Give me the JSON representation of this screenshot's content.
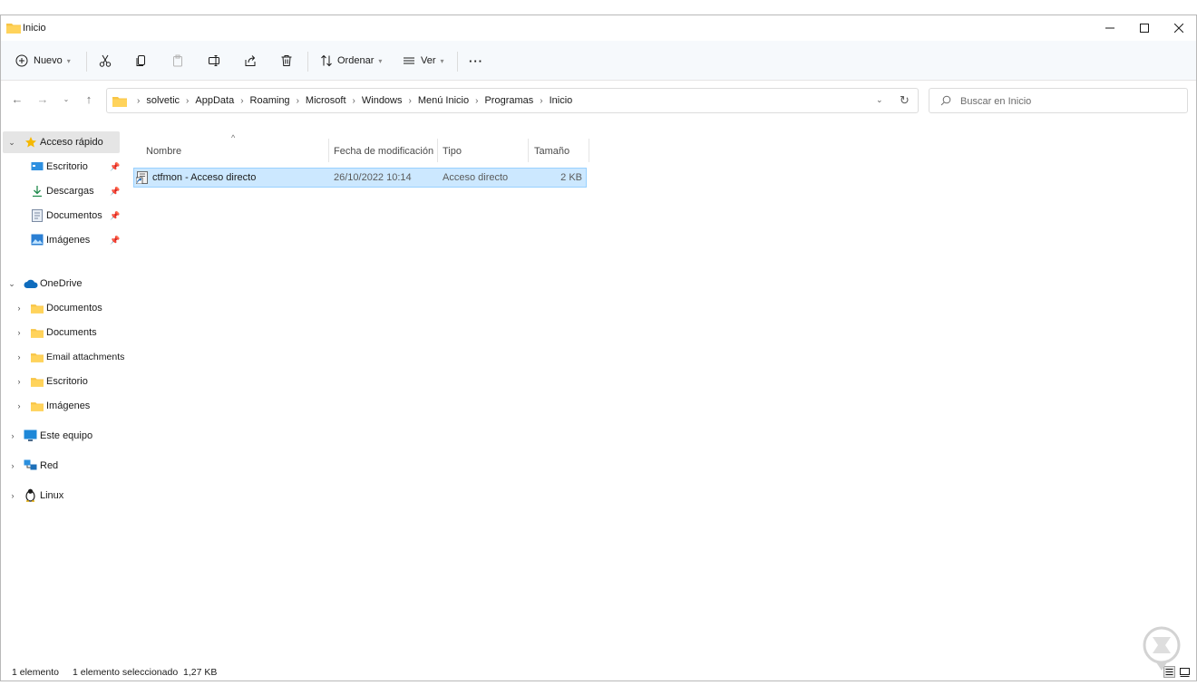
{
  "window": {
    "title": "Inicio",
    "controls": {
      "minimize": "—",
      "maximize": "☐",
      "close": "✕"
    }
  },
  "toolbar": {
    "new_label": "Nuevo",
    "sort_label": "Ordenar",
    "view_label": "Ver",
    "more_label": "···",
    "icons": [
      "cut-icon",
      "copy-icon",
      "paste-icon",
      "rename-icon",
      "share-icon",
      "delete-icon"
    ]
  },
  "address": {
    "breadcrumbs": [
      "solvetic",
      "AppData",
      "Roaming",
      "Microsoft",
      "Windows",
      "Menú Inicio",
      "Programas",
      "Inicio"
    ]
  },
  "search": {
    "placeholder": "Buscar en Inicio"
  },
  "sidebar": {
    "quick_access": {
      "label": "Acceso rápido",
      "items": [
        {
          "label": "Escritorio",
          "icon": "desktop-icon"
        },
        {
          "label": "Descargas",
          "icon": "download-icon"
        },
        {
          "label": "Documentos",
          "icon": "document-icon"
        },
        {
          "label": "Imágenes",
          "icon": "pictures-icon"
        }
      ]
    },
    "onedrive": {
      "label": "OneDrive",
      "items": [
        {
          "label": "Documentos"
        },
        {
          "label": "Documents"
        },
        {
          "label": "Email attachments"
        },
        {
          "label": "Escritorio"
        },
        {
          "label": "Imágenes"
        }
      ]
    },
    "this_pc": {
      "label": "Este equipo"
    },
    "network": {
      "label": "Red"
    },
    "linux": {
      "label": "Linux"
    }
  },
  "file_list": {
    "columns": [
      "Nombre",
      "Fecha de modificación",
      "Tipo",
      "Tamaño"
    ],
    "rows": [
      {
        "name": "ctfmon - Acceso directo",
        "modified": "26/10/2022 10:14",
        "type": "Acceso directo",
        "size": "2 KB",
        "selected": true
      }
    ]
  },
  "status": {
    "count": "1 elemento",
    "selection": "1 elemento seleccionado  1,27 KB"
  },
  "colors": {
    "selection_fill": "#cce8ff",
    "selection_border": "#99d1ff",
    "folder_yellow": "#f8c545",
    "accent_blue": "#0067c0",
    "sidebar_selected": "#e5e5e5"
  }
}
